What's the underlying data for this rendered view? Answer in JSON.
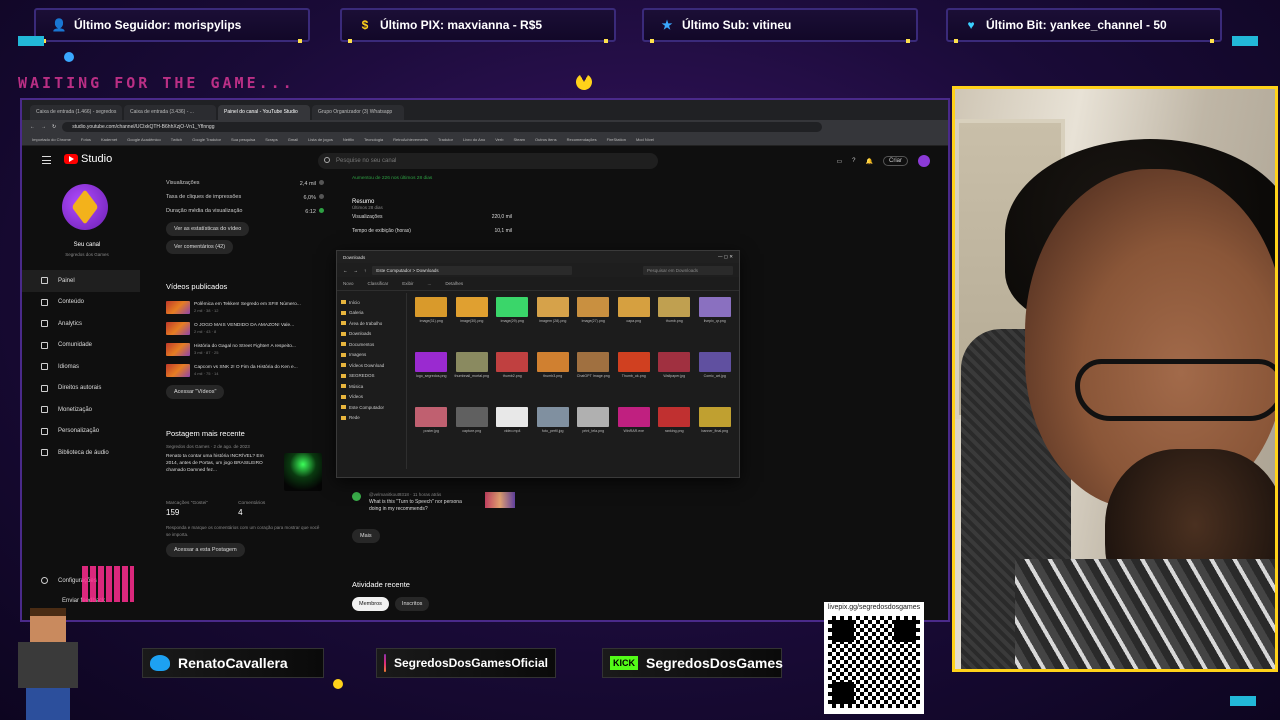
{
  "overlay": {
    "alerts": [
      {
        "icon": "user-icon",
        "text": "Último Seguidor: morispylips"
      },
      {
        "icon": "dollar-icon",
        "text": "Último PIX: maxvianna - R$5"
      },
      {
        "icon": "star-icon",
        "text": "Último Sub: vitineu"
      },
      {
        "icon": "heart-icon",
        "text": "Último Bit: yankee_channel - 50"
      }
    ],
    "waiting_text": "WAITING FOR THE GAME...",
    "socials": {
      "twitter": "RenatoCavallera",
      "instagram": "SegredosDosGamesOficial",
      "kick_label": "KICK",
      "kick": "SegredosDosGames"
    },
    "qr_label": "livepix.gg/segredosdosgames",
    "accent_color": "#ffd21a",
    "pink_color": "#ff3fa8"
  },
  "browser": {
    "tabs": [
      "Caixa de entrada (1.466) - segredos",
      "Caixa de entrada (3.436) - ...",
      "Painel do canal - YouTube Studio",
      "Grupo Organizador (3) Whatsapp"
    ],
    "url": "studio.youtube.com/channel/UCIxkQTH-B6hhXzjO-Vn1_Yflnngg",
    "bookmarks": [
      "Importado do Chrome",
      "Fotos",
      "Kadernet",
      "Google Acadêmico",
      "Twitch",
      "Google Tradutor",
      "Sua pesquisa",
      "Scraps",
      "Gmail",
      "Lista de jogos",
      "Netflix",
      "Tecnologia",
      "RetroAchievements",
      "Tradutor",
      "Livro do Ano",
      "Verb",
      "Steam",
      "Outros itens",
      "Recomendações",
      "FireStation",
      "Mod Nível"
    ]
  },
  "studio": {
    "logo": "Studio",
    "search_placeholder": "Pesquise no seu canal",
    "create_label": "Criar",
    "channel_name": "Seu canal",
    "channel_handle": "Segredos dos Games",
    "nav": [
      "Painel",
      "Conteúdo",
      "Analytics",
      "Comunidade",
      "Idiomas",
      "Direitos autorais",
      "Monetização",
      "Personalização",
      "Biblioteca de áudio"
    ],
    "settings": "Configurações",
    "feedback": "Enviar feedback",
    "metrics": [
      {
        "label": "Visualizações",
        "value": "2,4 mil"
      },
      {
        "label": "Taxa de cliques de impressões",
        "value": "6,0%"
      },
      {
        "label": "Duração média da visualização",
        "value": "6:12"
      }
    ],
    "btn_stats": "Ver as estatísticas do vídeo",
    "btn_comments": "Ver comentários (42)",
    "published_title": "Vídeos publicados",
    "videos": [
      {
        "title": "Polêmica em Tekken! Segredo em SFII! Número...",
        "meta": "2 mil · 38 · 12"
      },
      {
        "title": "O JOGO MAIS VENDIDO DA AMAZON! Vale...",
        "meta": "2 mil · 43 · 8"
      },
      {
        "title": "História do Gagal no Street Fighter! A respeito...",
        "meta": "3 mil · 87 · 25"
      },
      {
        "title": "Capcom vs SNK 2! O Fim da História do Ken e...",
        "meta": "4 mil · 75 · 14"
      }
    ],
    "btn_videos": "Acessar \"Vídeos\"",
    "post_title": "Postagem mais recente",
    "post_author": "Segredos dos Games",
    "post_date": "2 de ago. de 2023",
    "post_body": "Renato ta contar uma história INCRÍVEL? Em 2014, antes de Portas, um jogo BRASILEIRO chamado Damned fez...",
    "likes_label": "Marcações \"Gostei\"",
    "likes_value": "159",
    "comments_label": "Comentários",
    "comments_value": "4",
    "hint": "Responda e marque os comentários com um coração para mostrar que você se importa.",
    "btn_post": "Acessar a esta Postagem",
    "subs_line": "Aumentou de 226 nos últimos 28 dias",
    "resumo_title": "Resumo",
    "resumo_sub": "Últimos 28 dias",
    "resumo": [
      {
        "label": "Visualizações",
        "value": "220,0 mil"
      },
      {
        "label": "Tempo de exibição (horas)",
        "value": "10,1 mil"
      }
    ],
    "comment_author": "@velmanitkout9318 · 11 horas atrás",
    "comment_text": "What is this \"Turn to Speech\" nor persona doing in my recommends?",
    "btn_more": "Mais",
    "activity_title": "Atividade recente",
    "chip_members": "Membros",
    "chip_subs": "Inscritos"
  },
  "explorer": {
    "title": "Downloads",
    "path": "Este Computador > Downloads",
    "search_placeholder": "Pesquisar em Downloads",
    "toolbar": [
      "Novo",
      "Classificar",
      "Exibir",
      "...",
      "Detalhes"
    ],
    "sidebar": [
      "Início",
      "Galeria",
      "Área de trabalho",
      "Downloads",
      "Documentos",
      "Imagens",
      "Vídeos Download",
      "SEGREDOS",
      "Música",
      "Vídeos",
      "Este Computador",
      "Rede"
    ],
    "files": [
      {
        "name": "image(31).png",
        "color": "#d99a2b"
      },
      {
        "name": "image(30).png",
        "color": "#e0a030"
      },
      {
        "name": "image(29).png",
        "color": "#3ad66a"
      },
      {
        "name": "imagem (28).png",
        "color": "#d6a24a"
      },
      {
        "name": "image(27).png",
        "color": "#c99040"
      },
      {
        "name": "capa.png",
        "color": "#d6a040"
      },
      {
        "name": "thumb.png",
        "color": "#c0a050"
      },
      {
        "name": "livepix_qr.png",
        "color": "#8a70c0"
      },
      {
        "name": "logo_segredos.png",
        "color": "#9a2ad0"
      },
      {
        "name": "thumbnail_mortal.png",
        "color": "#8a8a60"
      },
      {
        "name": "thumb2.png",
        "color": "#c04040"
      },
      {
        "name": "thumb3.png",
        "color": "#d08030"
      },
      {
        "name": "ChatGPT Image.png",
        "color": "#a07040"
      },
      {
        "name": "Thumb_ok.png",
        "color": "#d04020"
      },
      {
        "name": "Wallpaper.jpg",
        "color": "#a03040"
      },
      {
        "name": "Comic_art.jpg",
        "color": "#6050a0"
      },
      {
        "name": "poster.jpg",
        "color": "#c06070"
      },
      {
        "name": "capture.png",
        "color": "#606060"
      },
      {
        "name": "video.mp4",
        "color": "#e8e8e8"
      },
      {
        "name": "foto_perfil.jpg",
        "color": "#8090a0"
      },
      {
        "name": "print_tela.png",
        "color": "#b0b0b0"
      },
      {
        "name": "WinRAR.exe",
        "color": "#c02080"
      },
      {
        "name": "ranking.png",
        "color": "#c03030"
      },
      {
        "name": "banner_final.png",
        "color": "#c0a030"
      }
    ]
  }
}
